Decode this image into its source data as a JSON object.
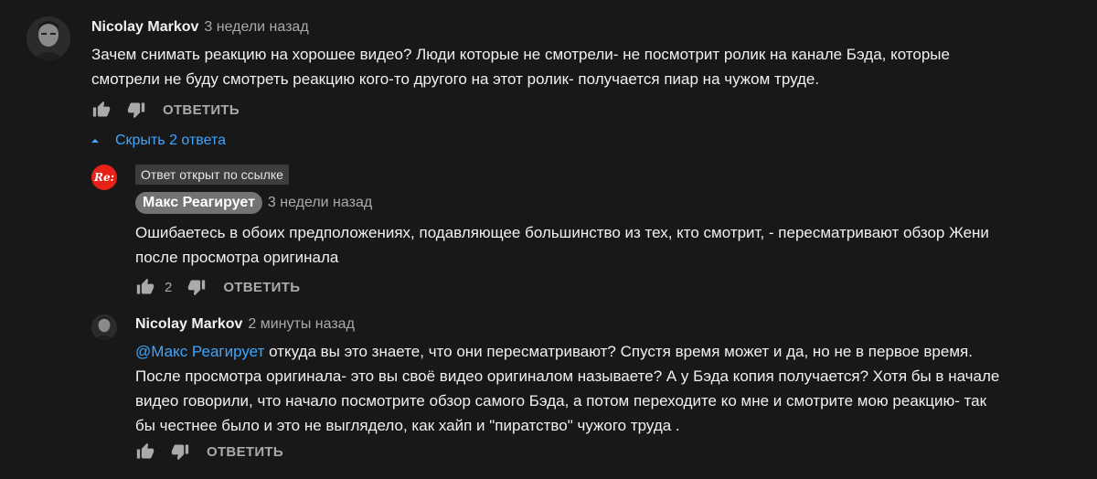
{
  "comment1": {
    "author": "Nicolay Markov",
    "time": "3 недели назад",
    "text_line1": "Зачем снимать реакцию на хорошее видео? Люди которые не смотрели- не посмотрит ролик на канале Бэда, которые",
    "text_line2": "смотрели не буду смотреть реакцию кого-то другого на этот ролик- получается пиар на чужом труде.",
    "reply_label": "ОТВЕТИТЬ"
  },
  "replies_toggle": {
    "label": "Скрыть 2 ответа"
  },
  "reply1": {
    "avatar_text": "Re:",
    "pinned_note": "Ответ открыт по ссылке",
    "author": "Макс Реагирует",
    "time": "3 недели назад",
    "text_line1": "Ошибаетесь в обоих предположениях, подавляющее большинство из тех, кто смотрит, - пересматривают обзор Жени",
    "text_line2": "после просмотра оригинала",
    "like_count": "2",
    "reply_label": "ОТВЕТИТЬ"
  },
  "reply2": {
    "author": "Nicolay Markov",
    "time": "2 минуты назад",
    "mention": "@Макс Реагирует",
    "text_line1_rest": " откуда вы это знаете, что они пересматривают? Спустя время может и да, но не в первое время.",
    "text_line2": "После просмотра оригинала- это вы своё видео оригиналом называете? А у Бэда копия получается? Хотя бы в начале",
    "text_line3": "видео говорили, что начало посмотрите обзор самого Бэда, а потом переходите ко мне и смотрите мою реакцию- так",
    "text_line4": "бы честнее было и это не выглядело, как хайп и \"пиратство\" чужого труда .",
    "reply_label": "ОТВЕТИТЬ"
  },
  "colors": {
    "background": "#181818",
    "link": "#3ea6ff",
    "muted": "#aaaaaa",
    "brand_red": "#e62117"
  }
}
